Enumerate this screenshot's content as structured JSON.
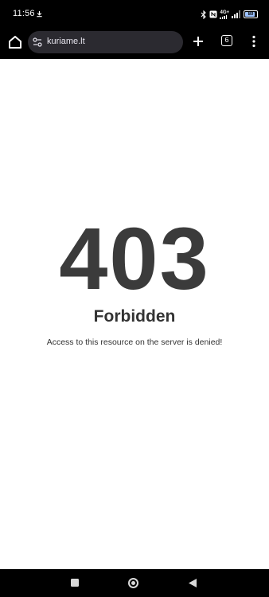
{
  "status_bar": {
    "time": "11:56",
    "network": "4G+",
    "battery": "80"
  },
  "browser": {
    "url": "kuriame.lt",
    "tab_count": "6"
  },
  "page": {
    "code": "403",
    "title": "Forbidden",
    "message": "Access to this resource on the server is denied!"
  },
  "icons": {
    "home": "home-icon",
    "site_settings": "tune-icon",
    "new_tab": "plus-icon",
    "tabs": "tab-switcher-icon",
    "menu": "more-vert-icon",
    "nav_recents": "square-icon",
    "nav_home": "circle-icon",
    "nav_back": "triangle-back-icon"
  },
  "colors": {
    "chrome": "#000000",
    "url_bar": "#2b2a30",
    "error_text": "#3b3b3b",
    "page_bg": "#ffffff"
  }
}
